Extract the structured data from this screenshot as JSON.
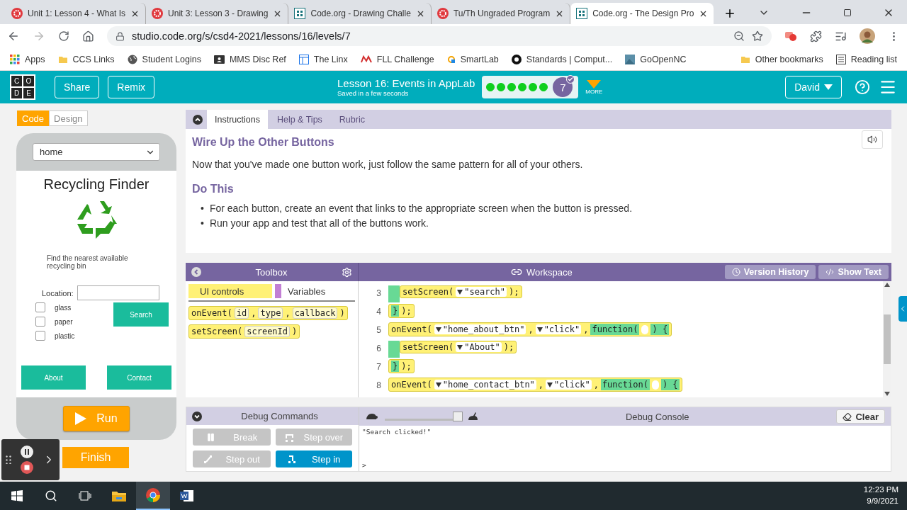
{
  "browser": {
    "tabs": [
      {
        "title": "Unit 1: Lesson 4 - What Is",
        "kind": "flower",
        "selected": false
      },
      {
        "title": "Unit 3: Lesson 3 - Drawing",
        "kind": "flower",
        "selected": false
      },
      {
        "title": "Code.org - Drawing Challe",
        "kind": "grid",
        "selected": false
      },
      {
        "title": "Tu/Th Ungraded Program",
        "kind": "flower",
        "selected": false
      },
      {
        "title": "Code.org - The Design Pro",
        "kind": "grid",
        "selected": true
      }
    ],
    "address": "studio.code.org/s/csd4-2021/lessons/16/levels/7",
    "bookmarks": [
      {
        "label": "Apps",
        "kind": "apps"
      },
      {
        "label": "CCS Links",
        "kind": "folder"
      },
      {
        "label": "Student Logins",
        "kind": "globe"
      },
      {
        "label": "MMS Disc Ref",
        "kind": "contact"
      },
      {
        "label": "The Linx",
        "kind": "window"
      },
      {
        "label": "FLL Challenge",
        "kind": "fll"
      },
      {
        "label": "SmartLab",
        "kind": "smart"
      },
      {
        "label": "Standards | Comput...",
        "kind": "dark"
      },
      {
        "label": "GoOpenNC",
        "kind": "image"
      }
    ],
    "bookmarks_right": [
      {
        "label": "Other bookmarks",
        "kind": "folder"
      },
      {
        "label": "Reading list",
        "kind": "list"
      }
    ]
  },
  "header": {
    "logo_letters": [
      "C",
      "O",
      "D",
      "E"
    ],
    "buttons": [
      "Share",
      "Remix"
    ],
    "title": "Lesson 16: Events in AppLab",
    "subtitle": "Saved in a few seconds",
    "progress": [
      {
        "done": true
      },
      {
        "done": true
      },
      {
        "done": true
      },
      {
        "done": true
      },
      {
        "done": true
      },
      {
        "done": true
      }
    ],
    "current_level": "7",
    "more": "MORE",
    "user": "David"
  },
  "left": {
    "mode_tabs": [
      {
        "label": "Code",
        "selected": true
      },
      {
        "label": "Design",
        "selected": false
      }
    ],
    "screen_select": "home",
    "app": {
      "title": "Recycling Finder",
      "description": "Find the nearest available recycling bin",
      "location_label": "Location:",
      "checkboxes": [
        {
          "label": "glass",
          "checked": false
        },
        {
          "label": "paper",
          "checked": false
        },
        {
          "label": "plastic",
          "checked": false
        }
      ],
      "search_button": "Search",
      "nav_buttons": [
        "About",
        "Contact"
      ]
    },
    "run_button": "Run",
    "finish_button": "Finish"
  },
  "instructions": {
    "tabs": [
      {
        "label": "Instructions",
        "selected": true
      },
      {
        "label": "Help & Tips",
        "selected": false
      },
      {
        "label": "Rubric",
        "selected": false
      }
    ],
    "heading": "Wire Up the Other Buttons",
    "paragraph": "Now that you've made one button work, just follow the same pattern for all of your others.",
    "subheading": "Do This",
    "bullet_marker": "•",
    "bullets": [
      "For each button, create an event that links to the appropriate screen when the button is pressed.",
      "Run your app and test that all of the buttons work."
    ]
  },
  "toolbox": {
    "title": "Toolbox",
    "categories": [
      {
        "label": "UI controls",
        "color": "#fff176",
        "selected": true
      },
      {
        "label": "Variables",
        "color": "#c27fd4",
        "selected": false
      }
    ],
    "blocks": [
      [
        {
          "kind": "text",
          "text": "onEvent("
        },
        {
          "kind": "param",
          "text": "id"
        },
        {
          "kind": "text",
          "text": ","
        },
        {
          "kind": "param",
          "text": "type"
        },
        {
          "kind": "text",
          "text": ","
        },
        {
          "kind": "param",
          "text": "callback"
        },
        {
          "kind": "text",
          "text": ")"
        }
      ],
      [
        {
          "kind": "text",
          "text": "setScreen("
        },
        {
          "kind": "param",
          "text": "screenId"
        },
        {
          "kind": "text",
          "text": ")"
        }
      ]
    ]
  },
  "workspace": {
    "title": "Workspace",
    "buttons": [
      "Version History",
      "Show Text"
    ],
    "lines": [
      {
        "number": "3",
        "kind": "nested",
        "segments": [
          {
            "kind": "text",
            "text": "setScreen("
          },
          {
            "kind": "dropdown",
            "text": "\"search\""
          },
          {
            "kind": "text",
            "text": ");"
          }
        ]
      },
      {
        "number": "4",
        "kind": "close",
        "segments": [
          {
            "kind": "function",
            "text": "}"
          },
          {
            "kind": "text",
            "text": ");"
          }
        ]
      },
      {
        "number": "5",
        "kind": "event",
        "segments": [
          {
            "kind": "text",
            "text": "onEvent("
          },
          {
            "kind": "dropdown",
            "text": "\"home_about_btn\""
          },
          {
            "kind": "text",
            "text": ","
          },
          {
            "kind": "dropdown",
            "text": "\"click\""
          },
          {
            "kind": "text",
            "text": ","
          },
          {
            "kind": "function",
            "text": "function("
          },
          {
            "kind": "slot"
          },
          {
            "kind": "function",
            "text": ") {"
          }
        ]
      },
      {
        "number": "6",
        "kind": "nested",
        "segments": [
          {
            "kind": "text",
            "text": "setScreen("
          },
          {
            "kind": "dropdown",
            "text": "\"About\""
          },
          {
            "kind": "text",
            "text": ");"
          }
        ]
      },
      {
        "number": "7",
        "kind": "close",
        "segments": [
          {
            "kind": "function",
            "text": "}"
          },
          {
            "kind": "text",
            "text": ");"
          }
        ]
      },
      {
        "number": "8",
        "kind": "event",
        "segments": [
          {
            "kind": "text",
            "text": "onEvent("
          },
          {
            "kind": "dropdown",
            "text": "\"home_contact_btn\""
          },
          {
            "kind": "text",
            "text": ","
          },
          {
            "kind": "dropdown",
            "text": "\"click\""
          },
          {
            "kind": "text",
            "text": ","
          },
          {
            "kind": "function",
            "text": "function("
          },
          {
            "kind": "slot"
          },
          {
            "kind": "function",
            "text": ") {"
          }
        ]
      }
    ]
  },
  "debug": {
    "commands_title": "Debug Commands",
    "commands": [
      {
        "label": "Break",
        "kind": "break",
        "disabled": true
      },
      {
        "label": "Step over",
        "kind": "over",
        "disabled": true
      },
      {
        "label": "Step out",
        "kind": "out",
        "disabled": true
      },
      {
        "label": "Step in",
        "kind": "in",
        "disabled": false
      }
    ],
    "speed": {
      "level": 1
    },
    "console_title": "Debug Console",
    "clear_button": "Clear",
    "console_lines": [
      "\"Search clicked!\""
    ],
    "prompt": ">"
  },
  "taskbar": {
    "time": "12:23 PM",
    "date": "9/9/2021"
  }
}
